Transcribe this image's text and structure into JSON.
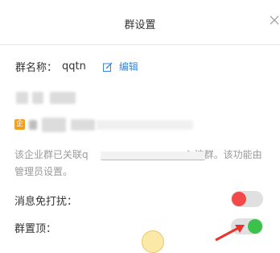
{
  "header": {
    "title": "群设置",
    "close_icon": "close-icon"
  },
  "group": {
    "name_label": "群名称：",
    "name_value": "qqtn",
    "edit_label": "编辑",
    "edit_icon": "edit-icon",
    "corp_badge": "企"
  },
  "notice": {
    "text": "该企业群已关联q　　　　　　　　　　入该群。该功能由管理员设置。"
  },
  "settings": [
    {
      "label": "消息免打扰：",
      "state": "off"
    },
    {
      "label": "群置顶：",
      "state": "on"
    }
  ],
  "colors": {
    "accent_blue": "#3a86d8",
    "toggle_off_knob": "#f24a4a",
    "toggle_on_knob": "#3cc24a",
    "annotation_arrow": "#e8332f",
    "badge": "#f0a020"
  }
}
